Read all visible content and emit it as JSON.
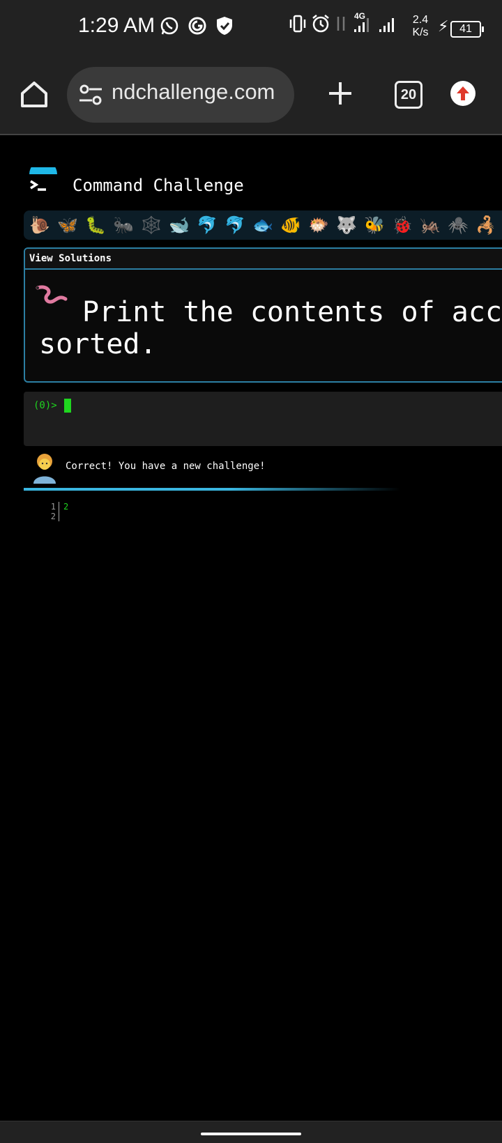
{
  "status_bar": {
    "time": "1:29 AM",
    "network_type": "4G",
    "net_speed_value": "2.4",
    "net_speed_unit": "K/s",
    "battery": "41",
    "icons": [
      "whatsapp-icon",
      "sync-icon",
      "shield-icon",
      "vibrate-icon",
      "alarm-icon",
      "data-arrows-icon",
      "signal-icon",
      "signal-icon",
      "charging-icon",
      "battery-icon"
    ]
  },
  "browser": {
    "url": "ndchallenge.com",
    "tab_count": "20",
    "icons": [
      "home-icon",
      "site-settings-icon",
      "plus-icon",
      "tabs-icon",
      "update-icon"
    ]
  },
  "site": {
    "title": "Command Challenge",
    "animals": [
      "🐌",
      "🦋",
      "🐛",
      "🐜",
      "🕸️",
      "🐋",
      "🐬",
      "🐬",
      "🐟",
      "🐠",
      "🐡",
      "🐺",
      "🐝",
      "🐞",
      "🦗",
      "🕷️",
      "🦂"
    ]
  },
  "challenge": {
    "view_solutions": "View Solutions",
    "text": "Print the contents of acce sorted."
  },
  "terminal": {
    "prompt": "(0)>"
  },
  "result": {
    "message": "Correct! You have a new challenge!"
  },
  "output": {
    "lines": [
      {
        "num": "1",
        "value": "2"
      },
      {
        "num": "2",
        "value": ""
      }
    ]
  },
  "colors": {
    "terminal_green": "#1fd61f",
    "accent_blue": "#3ab6e0",
    "panel_border": "#2c7fa3"
  }
}
